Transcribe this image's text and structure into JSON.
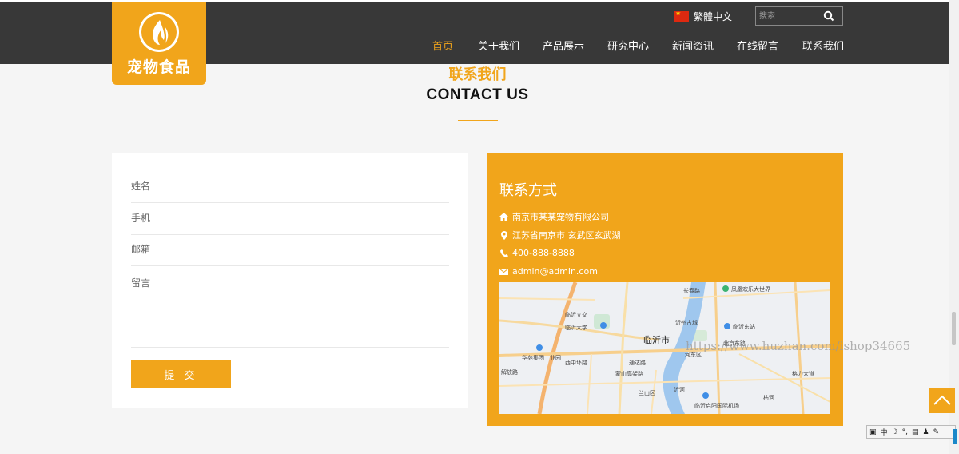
{
  "brand": {
    "logo_text": "宠物食品",
    "accent": "#f1a51b"
  },
  "header": {
    "language": "繁體中文",
    "search_placeholder": "搜索",
    "nav": [
      {
        "label": "首页",
        "active": true
      },
      {
        "label": "关于我们"
      },
      {
        "label": "产品展示"
      },
      {
        "label": "研究中心"
      },
      {
        "label": "新闻资讯"
      },
      {
        "label": "在线留言"
      },
      {
        "label": "联系我们"
      }
    ]
  },
  "section": {
    "title_cn": "联系我们",
    "title_en": "CONTACT US"
  },
  "form": {
    "name_placeholder": "姓名",
    "phone_placeholder": "手机",
    "email_placeholder": "邮箱",
    "message_placeholder": "留言",
    "submit_label": "提 交"
  },
  "contact": {
    "title": "联系方式",
    "company": "南京市某某宠物有限公司",
    "address": "江苏省南京市 玄武区玄武湖",
    "phone": "400-888-8888",
    "email": "admin@admin.com"
  },
  "map": {
    "city": "临沂市",
    "labels": [
      "长春路",
      "凤凰欢乐大世界",
      "临沂立交",
      "沂州古城",
      "临沂大学",
      "临沂东站",
      "北京东路",
      "河东区",
      "华苑集团工业园",
      "西中环路",
      "解放路",
      "通达路",
      "蒙山高架路",
      "兰山区",
      "沂河",
      "临沂启阳国际机场",
      "枋河",
      "格力大道"
    ]
  },
  "watermark": "https://www.huzhan.com/ishop34665",
  "ime": {
    "mode": "中"
  }
}
